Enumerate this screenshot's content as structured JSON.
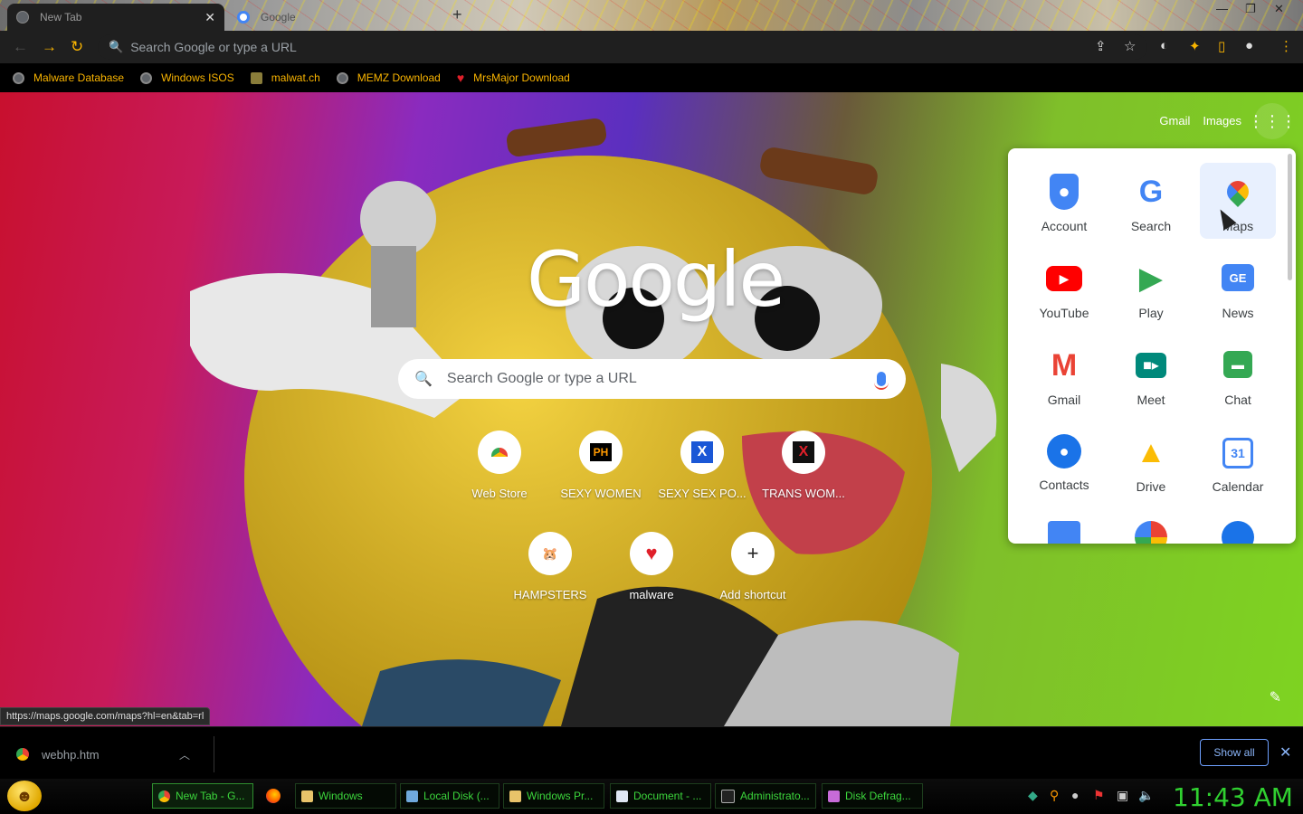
{
  "tabs": [
    {
      "title": "New Tab",
      "active": true
    },
    {
      "title": "Google",
      "active": false
    }
  ],
  "toolbar": {
    "omnibox_placeholder": "Search Google or type a URL"
  },
  "bookmarks": [
    {
      "label": "Malware Database",
      "icon": "globe-icon"
    },
    {
      "label": "Windows ISOS",
      "icon": "globe-icon"
    },
    {
      "label": "malwat.ch",
      "icon": "malwatch-icon"
    },
    {
      "label": "MEMZ Download",
      "icon": "globe-icon"
    },
    {
      "label": "MrsMajor Download",
      "icon": "heart-icon"
    }
  ],
  "page": {
    "header_links": {
      "gmail": "Gmail",
      "images": "Images"
    },
    "logo": "Google",
    "search_placeholder": "Search Google or type a URL",
    "shortcuts": [
      {
        "label": "Web Store",
        "icon": "webstore-icon"
      },
      {
        "label": "SEXY WOMEN",
        "icon": "ph-icon",
        "glyph": "PH"
      },
      {
        "label": "SEXY SEX PO...",
        "icon": "x-blue-icon",
        "glyph": "X"
      },
      {
        "label": "TRANS WOM...",
        "icon": "x-red-icon",
        "glyph": "X"
      },
      {
        "label": "HAMPSTERS",
        "icon": "hamster-icon"
      },
      {
        "label": "malware",
        "icon": "heart-icon"
      },
      {
        "label": "Add shortcut",
        "icon": "plus-icon",
        "glyph": "+"
      }
    ]
  },
  "apps_panel": {
    "apps": [
      {
        "label": "Account",
        "icon": "account-icon",
        "color": "#4285f4"
      },
      {
        "label": "Search",
        "icon": "google-icon",
        "color": "#4285f4"
      },
      {
        "label": "Maps",
        "icon": "maps-icon",
        "color": "#ea4335"
      },
      {
        "label": "YouTube",
        "icon": "youtube-icon",
        "color": "#ff0000"
      },
      {
        "label": "Play",
        "icon": "play-icon",
        "color": "#34a853"
      },
      {
        "label": "News",
        "icon": "news-icon",
        "color": "#4285f4"
      },
      {
        "label": "Gmail",
        "icon": "gmail-icon",
        "color": "#ea4335"
      },
      {
        "label": "Meet",
        "icon": "meet-icon",
        "color": "#00897b"
      },
      {
        "label": "Chat",
        "icon": "chat-icon",
        "color": "#34a853"
      },
      {
        "label": "Contacts",
        "icon": "contacts-icon",
        "color": "#1a73e8"
      },
      {
        "label": "Drive",
        "icon": "drive-icon",
        "color": "#fbbc05"
      },
      {
        "label": "Calendar",
        "icon": "calendar-icon",
        "color": "#4285f4",
        "glyph": "31"
      }
    ],
    "hovered": "Maps"
  },
  "status_url": "https://maps.google.com/maps?hl=en&tab=rl",
  "download_shelf": {
    "filename": "webhp.htm",
    "show_all": "Show all"
  },
  "taskbar": {
    "tasks": [
      {
        "label": "New Tab - G...",
        "active": true
      },
      {
        "label": "Windows",
        "active": false
      },
      {
        "label": "Local Disk (...",
        "active": false
      },
      {
        "label": "Windows Pr...",
        "active": false
      },
      {
        "label": "Document - ...",
        "active": false
      },
      {
        "label": "Administrato...",
        "active": false
      },
      {
        "label": "Disk Defrag...",
        "active": false
      }
    ],
    "clock": "11:43 AM"
  }
}
